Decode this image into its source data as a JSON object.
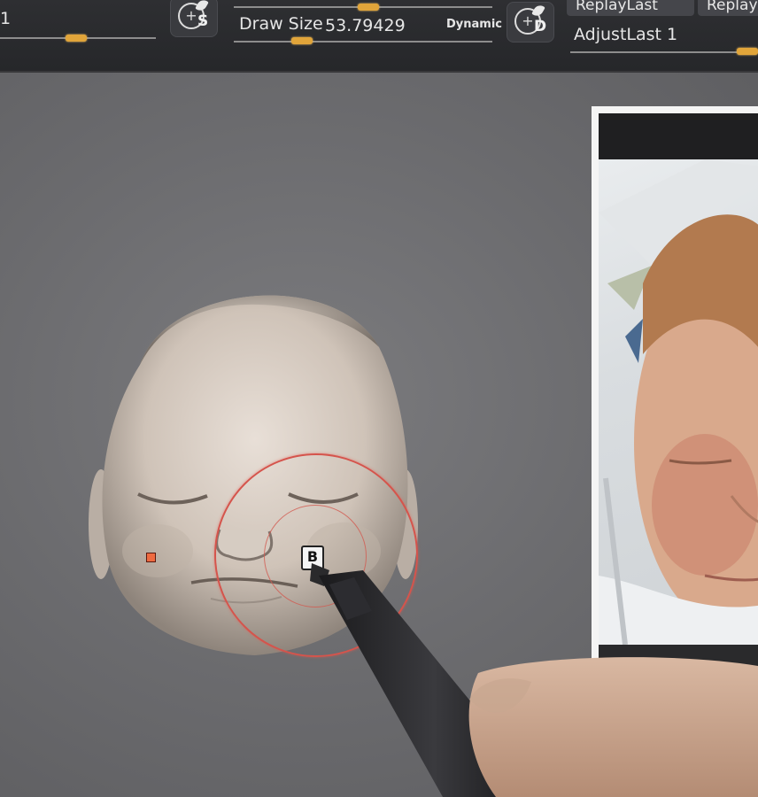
{
  "toolbar": {
    "left_value": "1",
    "brush_s": {
      "letter": "S"
    },
    "draw_size": {
      "label": "Draw Size",
      "value": "53.79429",
      "mode": "Dynamic"
    },
    "brush_d": {
      "letter": "D"
    },
    "replay_last": "ReplayLast",
    "replay_last_clipped": "ReplayL",
    "adjust_last": {
      "label": "AdjustLast",
      "value": "1"
    }
  },
  "colors": {
    "toolbar_bg": "#2b2c2f",
    "slider_thumb": "#e1a53a",
    "viewport_bg": "#6b6b6e",
    "brush_cursor": "#d5544c",
    "marker": "#ee6a40"
  },
  "icons": {
    "brush_s": "brush-plus-icon",
    "brush_d": "brush-plus-icon",
    "cursor": "brush-cursor-icon"
  }
}
